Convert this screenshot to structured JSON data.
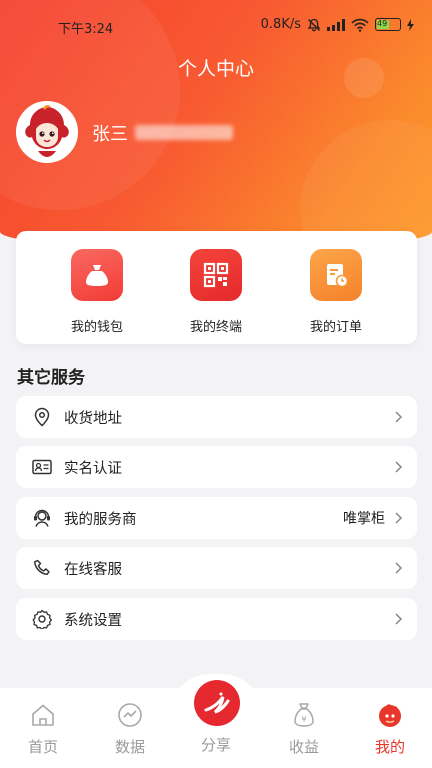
{
  "status_bar": {
    "time": "下午3:24",
    "network_speed": "0.8K/s",
    "battery": "49"
  },
  "header": {
    "title": "个人中心"
  },
  "profile": {
    "name": "张三"
  },
  "quick_actions": [
    {
      "label": "我的钱包",
      "icon": "money-bag-icon",
      "color": "#f4493f"
    },
    {
      "label": "我的终端",
      "icon": "qr-code-icon",
      "color": "#f0322e"
    },
    {
      "label": "我的订单",
      "icon": "order-list-icon",
      "color": "#f7852a"
    }
  ],
  "services": {
    "title": "其它服务",
    "items": [
      {
        "label": "收货地址",
        "icon": "location-pin-icon",
        "value": ""
      },
      {
        "label": "实名认证",
        "icon": "id-card-icon",
        "value": ""
      },
      {
        "label": "我的服务商",
        "icon": "headset-icon",
        "value": "唯掌柜"
      },
      {
        "label": "在线客服",
        "icon": "phone-icon",
        "value": ""
      },
      {
        "label": "系统设置",
        "icon": "gear-icon",
        "value": ""
      }
    ]
  },
  "tabbar": {
    "active_color": "#e8362a",
    "items": [
      {
        "label": "首页",
        "icon": "home-icon"
      },
      {
        "label": "数据",
        "icon": "chart-icon"
      },
      {
        "label": "分享",
        "icon": "share-icon"
      },
      {
        "label": "收益",
        "icon": "money-bag-icon"
      },
      {
        "label": "我的",
        "icon": "profile-icon"
      }
    ]
  }
}
